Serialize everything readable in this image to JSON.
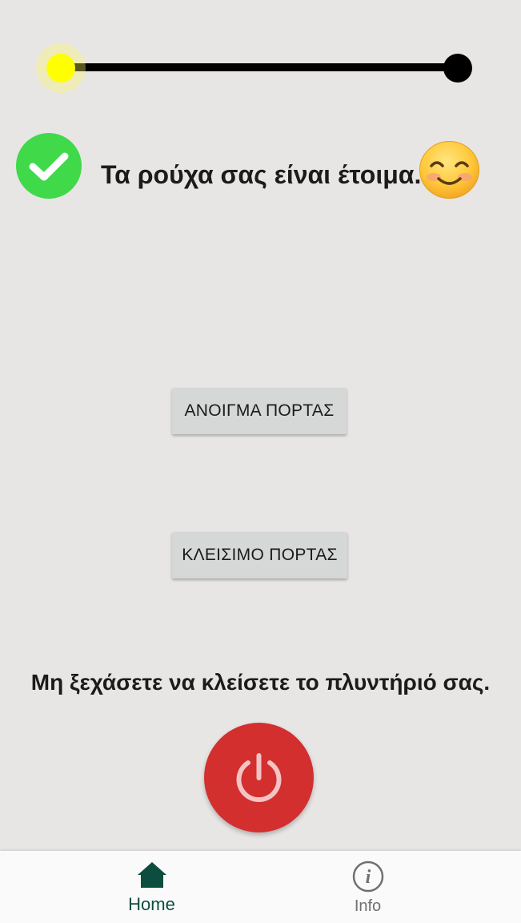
{
  "slider": {
    "value": 0.0
  },
  "status": {
    "text": "Τα ρούχα σας είναι έτοιμα.",
    "icon_check": "check-circle-icon",
    "icon_smile": "smiling-face-emoji-icon",
    "check_color": "#3fd94a"
  },
  "buttons": {
    "open_door": "ΑΝΟΙΓΜΑ ΠΟΡΤΑΣ",
    "close_door": "ΚΛΕΙΣΙΜΟ ΠΟΡΤΑΣ"
  },
  "reminder": {
    "text": "Μη ξεχάσετε να κλείσετε το πλυντήριό σας."
  },
  "power": {
    "icon": "power-icon",
    "color": "#d32f2f"
  },
  "nav": {
    "items": [
      {
        "label": "Home",
        "icon": "home-icon",
        "active": true
      },
      {
        "label": "Info",
        "icon": "info-icon",
        "active": false
      }
    ],
    "active_color": "#0d4d3f"
  }
}
